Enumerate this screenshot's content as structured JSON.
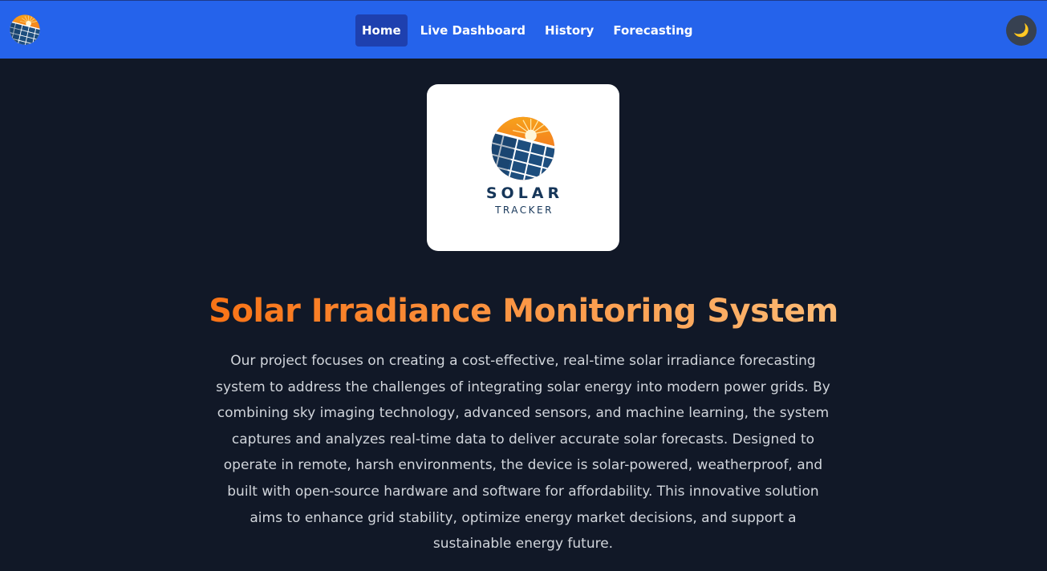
{
  "navbar": {
    "logo_icon": "solar-tracker-logo-icon",
    "links": [
      {
        "label": "Home",
        "active": true
      },
      {
        "label": "Live Dashboard",
        "active": false
      },
      {
        "label": "History",
        "active": false
      },
      {
        "label": "Forecasting",
        "active": false
      }
    ],
    "theme_toggle": {
      "glyph": "🌙",
      "icon": "moon-icon"
    }
  },
  "hero": {
    "brand_name": "SOLAR",
    "brand_sub": "TRACKER",
    "title": "Solar Irradiance Monitoring System",
    "description": "Our project focuses on creating a cost-effective, real-time solar irradiance forecasting system to address the challenges of integrating solar energy into modern power grids. By combining sky imaging technology, advanced sensors, and machine learning, the system captures and analyzes real-time data to deliver accurate solar forecasts. Designed to operate in remote, harsh environments, the device is solar-powered, weatherproof, and built with open-source hardware and software for affordability. This innovative solution aims to enhance grid stability, optimize energy market decisions, and support a sustainable energy future."
  },
  "colors": {
    "navbar": "#2563eb",
    "active_link": "#1e40af",
    "background": "#111827",
    "title_gradient_start": "#f97316",
    "title_gradient_end": "#fdba74",
    "body_text": "#d1d5db",
    "brand_navy": "#163659"
  }
}
